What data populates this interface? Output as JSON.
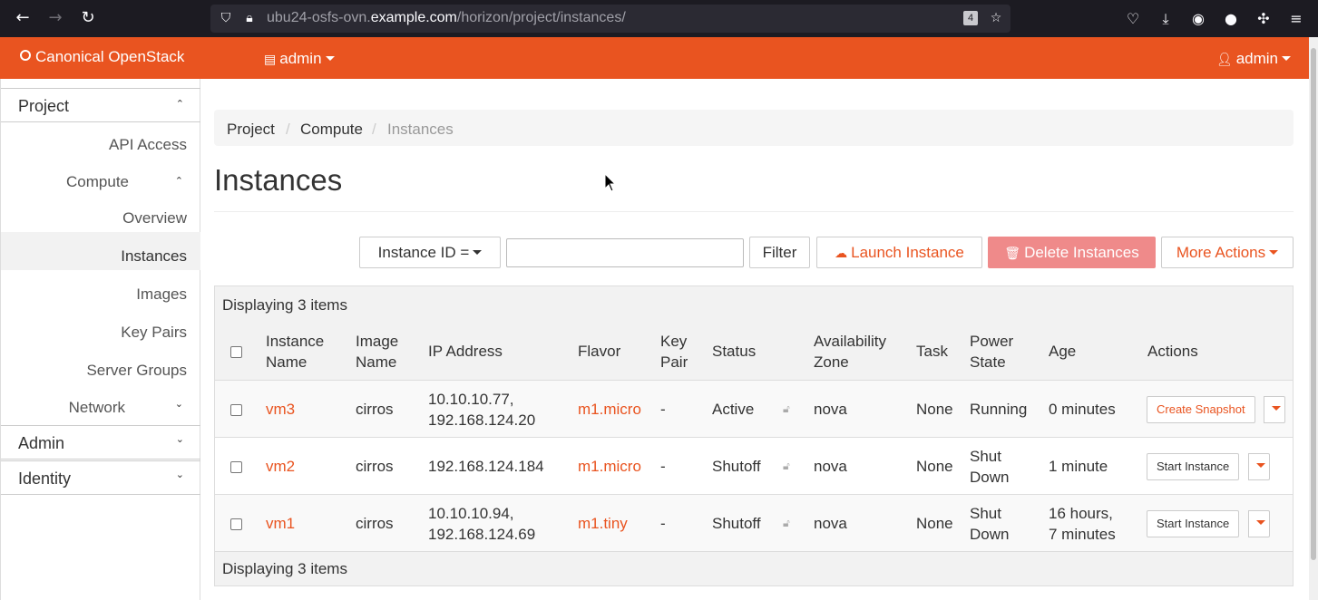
{
  "browser": {
    "url_prefix": "ubu24-osfs-ovn.",
    "url_host": "example.com",
    "url_path": "/horizon/project/instances/",
    "tab_count": "4"
  },
  "header": {
    "brand": "Canonical OpenStack",
    "project_selector": "admin",
    "user_menu": "admin",
    "accent": "#e95420"
  },
  "sidebar": {
    "project": "Project",
    "api_access": "API Access",
    "compute": "Compute",
    "overview": "Overview",
    "instances": "Instances",
    "images": "Images",
    "key_pairs": "Key Pairs",
    "server_groups": "Server Groups",
    "network": "Network",
    "admin": "Admin",
    "identity": "Identity"
  },
  "breadcrumb": [
    "Project",
    "Compute",
    "Instances"
  ],
  "page_title": "Instances",
  "toolbar": {
    "filter_field": "Instance ID =",
    "filter_value": "",
    "filter_button": "Filter",
    "launch": "Launch Instance",
    "delete": "Delete Instances",
    "more": "More Actions"
  },
  "table": {
    "summary_top": "Displaying 3 items",
    "summary_bottom": "Displaying 3 items",
    "headers": {
      "name1": "Instance",
      "name2": "Name",
      "image1": "Image",
      "image2": "Name",
      "ip": "IP Address",
      "flavor": "Flavor",
      "key1": "Key",
      "key2": "Pair",
      "status": "Status",
      "az1": "Availability",
      "az2": "Zone",
      "task": "Task",
      "power1": "Power",
      "power2": "State",
      "age": "Age",
      "actions": "Actions"
    },
    "rows": [
      {
        "name": "vm3",
        "image": "cirros",
        "ip1": "10.10.10.77,",
        "ip2": "192.168.124.20",
        "flavor": "m1.micro",
        "key": "-",
        "status": "Active",
        "az": "nova",
        "task": "None",
        "power1": "Running",
        "power2": "",
        "age1": "0 minutes",
        "age2": "",
        "action": "Create Snapshot"
      },
      {
        "name": "vm2",
        "image": "cirros",
        "ip1": "192.168.124.184",
        "ip2": "",
        "flavor": "m1.micro",
        "key": "-",
        "status": "Shutoff",
        "az": "nova",
        "task": "None",
        "power1": "Shut",
        "power2": "Down",
        "age1": "1 minute",
        "age2": "",
        "action": "Start Instance"
      },
      {
        "name": "vm1",
        "image": "cirros",
        "ip1": "10.10.10.94,",
        "ip2": "192.168.124.69",
        "flavor": "m1.tiny",
        "key": "-",
        "status": "Shutoff",
        "az": "nova",
        "task": "None",
        "power1": "Shut",
        "power2": "Down",
        "age1": "16 hours,",
        "age2": "7 minutes",
        "action": "Start Instance"
      }
    ]
  }
}
